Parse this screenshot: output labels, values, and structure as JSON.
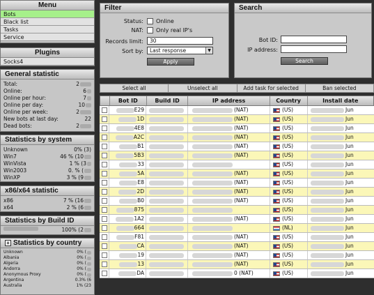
{
  "menu": {
    "title": "Menu",
    "items": [
      {
        "label": "Bots",
        "active": true
      },
      {
        "label": "Black list",
        "active": false
      },
      {
        "label": "Tasks",
        "active": false
      },
      {
        "label": "Service",
        "active": false
      }
    ]
  },
  "plugins": {
    "title": "Plugins",
    "items": [
      "Socks4"
    ]
  },
  "general": {
    "title": "General statistic",
    "rows": [
      {
        "label": "Total:",
        "value": "2"
      },
      {
        "label": "Online:",
        "value": "6"
      },
      {
        "label": "Online per hour:",
        "value": "7"
      },
      {
        "label": "Online per day:",
        "value": "10"
      },
      {
        "label": "Online per week:",
        "value": "2"
      },
      {
        "label": "New bots at last day:",
        "value": "22"
      },
      {
        "label": "Dead bots:",
        "value": "2"
      }
    ]
  },
  "by_system": {
    "title": "Statistics by system",
    "rows": [
      {
        "label": "Unknown",
        "value": "0% (3)"
      },
      {
        "label": "Win7",
        "value": "46 % (10"
      },
      {
        "label": "WinVista",
        "value": "1 % (3"
      },
      {
        "label": "Win2003",
        "value": "0. %  ("
      },
      {
        "label": "WinXP",
        "value": "3 % (9"
      }
    ]
  },
  "by_arch": {
    "title": "x86/x64 statistic",
    "rows": [
      {
        "label": "x86",
        "value": "7 % (16"
      },
      {
        "label": "x64",
        "value": "2 % (6"
      }
    ]
  },
  "by_build": {
    "title": "Statistics by Build ID",
    "value": "100% (2"
  },
  "by_country": {
    "title": "Statistics by country",
    "rows": [
      {
        "label": "Unknown",
        "value": "0% ("
      },
      {
        "label": "Albania",
        "value": "0% ("
      },
      {
        "label": "Algeria",
        "value": "0% ("
      },
      {
        "label": "Andorra",
        "value": "0% ("
      },
      {
        "label": "Anonymous Proxy",
        "value": "0% ("
      },
      {
        "label": "Argentina",
        "value": "0.3% (6"
      },
      {
        "label": "Australia",
        "value": "1% (23"
      }
    ]
  },
  "filter": {
    "title": "Filter",
    "status_label": "Status:",
    "online_label": "Online",
    "nat_label": "NAT:",
    "real_ip_label": "Only real IP's",
    "records_label": "Records limit:",
    "records_value": "30",
    "sort_label": "Sort by:",
    "sort_value": "Last response",
    "apply_label": "Apply"
  },
  "search": {
    "title": "Search",
    "botid_label": "Bot ID:",
    "ip_label": "IP address:",
    "button_label": "Search"
  },
  "actions": [
    "Select all",
    "Unselect all",
    "Add task for selected",
    "Ban selected"
  ],
  "table": {
    "headers": [
      "Bot ID",
      "Build ID",
      "IP address",
      "Country",
      "Install date"
    ],
    "rows": [
      {
        "bot": "E29",
        "ip": "(NAT)",
        "flag": "us",
        "country": "(US)",
        "date": "Jun"
      },
      {
        "bot": "1D",
        "ip": "(NAT)",
        "flag": "us",
        "country": "(US)",
        "date": "Jun"
      },
      {
        "bot": "4E8",
        "ip": "(NAT)",
        "flag": "us",
        "country": "(US)",
        "date": "Jun"
      },
      {
        "bot": "A2C",
        "ip": "(NAT)",
        "flag": "us",
        "country": "(US)",
        "date": "Jun"
      },
      {
        "bot": "B1",
        "ip": "(NAT)",
        "flag": "us",
        "country": "(US)",
        "date": "Jun"
      },
      {
        "bot": "5B3",
        "ip": "(NAT)",
        "flag": "us",
        "country": "(US)",
        "date": "Jun"
      },
      {
        "bot": "33",
        "ip": "",
        "flag": "us",
        "country": "(US)",
        "date": "Jun"
      },
      {
        "bot": "5A",
        "ip": "(NAT)",
        "flag": "us",
        "country": "(US)",
        "date": "Jun"
      },
      {
        "bot": "E8",
        "ip": "(NAT)",
        "flag": "us",
        "country": "(US)",
        "date": "Jun"
      },
      {
        "bot": "2D",
        "ip": "(NAT)",
        "flag": "us",
        "country": "(US)",
        "date": "Jun"
      },
      {
        "bot": "B0",
        "ip": "(NAT)",
        "flag": "us",
        "country": "(US)",
        "date": "Jun"
      },
      {
        "bot": "875",
        "ip": "",
        "flag": "us",
        "country": "(US)",
        "date": "Jun"
      },
      {
        "bot": "1A2",
        "ip": "(NAT)",
        "flag": "us",
        "country": "(US)",
        "date": "Jun"
      },
      {
        "bot": "664",
        "ip": "",
        "flag": "nl",
        "country": "(NL)",
        "date": "Jun"
      },
      {
        "bot": "F81",
        "ip": "(NAT)",
        "flag": "us",
        "country": "(US)",
        "date": "Jun"
      },
      {
        "bot": "CA",
        "ip": "(NAT)",
        "flag": "us",
        "country": "(US)",
        "date": "Jun"
      },
      {
        "bot": "19",
        "ip": "(NAT)",
        "flag": "us",
        "country": "(US)",
        "date": "Jun"
      },
      {
        "bot": "13",
        "ip": "(NAT)",
        "flag": "us",
        "country": "(US)",
        "date": "Jun"
      },
      {
        "bot": "DA",
        "ip": "0 (NAT)",
        "flag": "us",
        "country": "(US)",
        "date": "Jun"
      }
    ]
  }
}
